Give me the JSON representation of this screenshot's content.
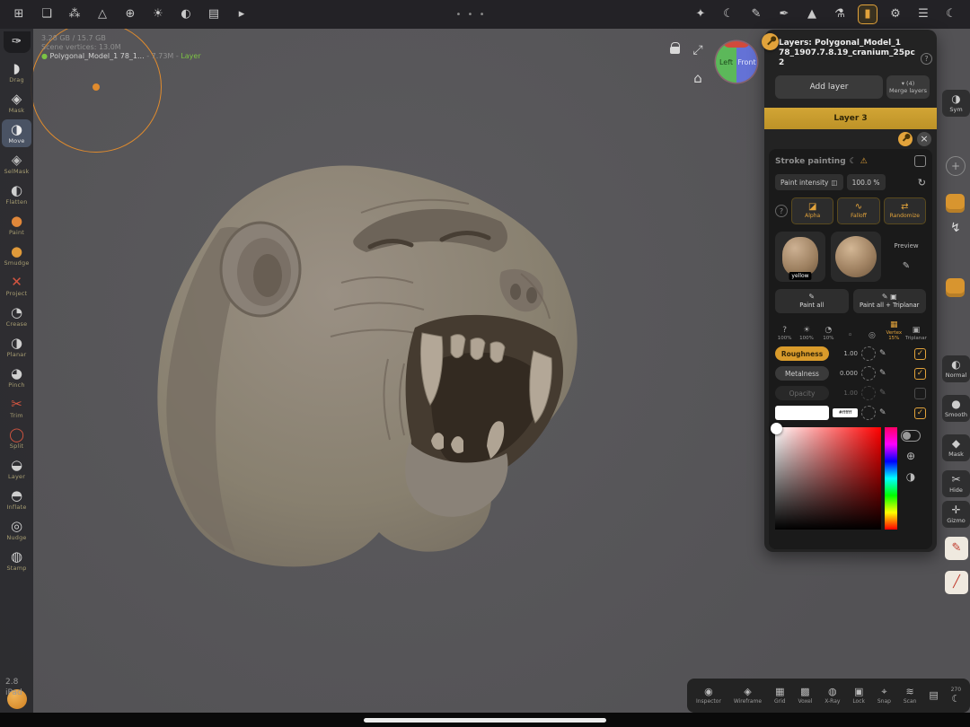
{
  "colors": {
    "accent": "#e2a33b",
    "layer_gold": "#c79e2f",
    "viewport_bg": "#59585b",
    "clay": "#8e867c",
    "tool_red": "#d35540",
    "tool_orange": "#e0873a"
  },
  "top_bar": {
    "left_icons": [
      {
        "name": "apps",
        "glyph": "⊞"
      },
      {
        "name": "files",
        "glyph": "❏"
      },
      {
        "name": "scene-graph",
        "glyph": "⁂"
      },
      {
        "name": "primitives",
        "glyph": "△"
      },
      {
        "name": "environment",
        "glyph": "⊕"
      },
      {
        "name": "lighting",
        "glyph": "☀"
      },
      {
        "name": "postprocess",
        "glyph": "◐"
      },
      {
        "name": "background",
        "glyph": "▤"
      },
      {
        "name": "camera",
        "glyph": "▸"
      }
    ],
    "menu_dots": "• • •",
    "right_icons": [
      {
        "name": "spray",
        "glyph": "✦"
      },
      {
        "name": "paint-mode",
        "glyph": "☾"
      },
      {
        "name": "pencil",
        "glyph": "✎"
      },
      {
        "name": "knife",
        "glyph": "✒"
      },
      {
        "name": "pyramid",
        "glyph": "▲"
      },
      {
        "name": "flask",
        "glyph": "⚗"
      },
      {
        "name": "material",
        "glyph": "▮"
      },
      {
        "name": "settings",
        "glyph": "⚙"
      },
      {
        "name": "sliders",
        "glyph": "☰"
      },
      {
        "name": "theme",
        "glyph": "☾"
      }
    ]
  },
  "left_toolbar": {
    "pen_glyph": "✑",
    "tools": [
      {
        "label": "Drag",
        "glyph": "◗",
        "color": "#d8d8d8"
      },
      {
        "label": "Mask",
        "glyph": "◈",
        "color": "#cfcfcf"
      },
      {
        "label": "Move",
        "glyph": "◑",
        "color": "#ececec"
      },
      {
        "label": "SelMask",
        "glyph": "◈",
        "color": "#b9b9b9"
      },
      {
        "label": "Flatten",
        "glyph": "◐",
        "color": "#cfcfcf"
      },
      {
        "label": "Paint",
        "glyph": "●",
        "color": "#e0873a"
      },
      {
        "label": "Smudge",
        "glyph": "●",
        "color": "#e09a3a"
      },
      {
        "label": "Project",
        "glyph": "✕",
        "color": "#d35540"
      },
      {
        "label": "Crease",
        "glyph": "◔",
        "color": "#cfcfcf"
      },
      {
        "label": "Planar",
        "glyph": "◑",
        "color": "#cfcfcf"
      },
      {
        "label": "Pinch",
        "glyph": "◕",
        "color": "#cfcfcf"
      },
      {
        "label": "Trim",
        "glyph": "✂",
        "color": "#d35540"
      },
      {
        "label": "Split",
        "glyph": "◯",
        "color": "#d35540"
      },
      {
        "label": "Layer",
        "glyph": "◒",
        "color": "#cfcfcf"
      },
      {
        "label": "Inflate",
        "glyph": "◓",
        "color": "#cfcfcf"
      },
      {
        "label": "Nudge",
        "glyph": "◎",
        "color": "#cfcfcf"
      },
      {
        "label": "Stamp",
        "glyph": "◍",
        "color": "#cfcfcf"
      }
    ]
  },
  "status": {
    "memory": "3.28 GB / 15.7 GB",
    "vertices": "Scene vertices:  13.0M",
    "model_dot": "●",
    "model_name": "Polygonal_Model_1 78_1...",
    "model_size": "- 7.73M -",
    "model_layer": "Layer"
  },
  "viewport_controls": {
    "expand_glyph": "⤢",
    "home_glyph": "⌂"
  },
  "nav_cube": {
    "left": "Left",
    "front": "Front"
  },
  "layers_panel": {
    "title_line1": "Layers:  Polygonal_Model_1",
    "title_line2": "78_1907.7.8.19_cranium_25pc 2",
    "help_glyph": "?",
    "add_layer": "Add layer",
    "merge_top": "▾ (4)",
    "merge_label": "Merge layers",
    "active_layer": "Layer 3",
    "close_glyph": "×",
    "stroke": {
      "title": "Stroke painting",
      "moon_glyph": "☾",
      "warning_glyph": "⚠",
      "intensity_label": "Paint intensity",
      "slider_glyph": "◫",
      "intensity_value": "100.0 %",
      "reset_glyph": "↻",
      "help_glyph": "?",
      "tabs": [
        {
          "label": "Alpha",
          "glyph": "◪"
        },
        {
          "label": "Falloff",
          "glyph": "∿"
        },
        {
          "label": "Randomize",
          "glyph": "⇄"
        }
      ],
      "swatch_label": "yellow",
      "preview_label": "Preview",
      "edit_glyph": "✎",
      "paint_all": {
        "label": "Paint all",
        "glyph": "✎"
      },
      "paint_all_triplanar": {
        "label": "Paint all + Triplanar",
        "glyph": "✎ ▣"
      },
      "toggles": [
        {
          "label": "100%",
          "glyph": "?"
        },
        {
          "label": "100%",
          "glyph": "☀"
        },
        {
          "label": "10%",
          "glyph": "◔"
        },
        {
          "label": "",
          "glyph": "◦"
        },
        {
          "label": "",
          "glyph": "◎"
        },
        {
          "label": "Vertex 15%",
          "glyph": "▦"
        },
        {
          "label": "Triplanar",
          "glyph": "▣"
        }
      ],
      "materials": [
        {
          "label": "Roughness",
          "value": "1.00"
        },
        {
          "label": "Metalness",
          "value": "0.000"
        },
        {
          "label": "Opacity",
          "value": "1.00"
        }
      ],
      "color_hex": "#ffffff",
      "picker_glyphs": {
        "target": "⊕",
        "half": "◑"
      }
    }
  },
  "right_edge": {
    "sym": {
      "label": "Sym",
      "glyph": "◑"
    },
    "add_glyph": "+",
    "bolt_glyph": "↯",
    "normal": {
      "label": "Normal",
      "glyph": "◐"
    },
    "smooth": {
      "label": "Smooth",
      "glyph": "●"
    },
    "mask": {
      "label": "Mask",
      "glyph": "◆"
    },
    "hide": {
      "label": "Hide",
      "glyph": "✂"
    },
    "gizmo": {
      "label": "Gizmo",
      "glyph": "✛"
    },
    "pencil_glyph": "✎",
    "slash_glyph": "╱"
  },
  "bottom_bar": {
    "items": [
      {
        "label": "Inspector",
        "glyph": "◉"
      },
      {
        "label": "Wireframe",
        "glyph": "◈"
      },
      {
        "label": "Grid",
        "glyph": "▦"
      },
      {
        "label": "Voxel",
        "glyph": "▩"
      },
      {
        "label": "X-Ray",
        "glyph": "◍"
      },
      {
        "label": "Lock",
        "glyph": "▣"
      },
      {
        "label": "Snap",
        "glyph": "⌖"
      },
      {
        "label": "Scan",
        "glyph": "≋"
      },
      {
        "label": "",
        "glyph": "▤"
      }
    ],
    "angle": {
      "value": "270",
      "glyph": "☾"
    }
  },
  "version": {
    "number": "2.8",
    "device": "iPad"
  }
}
